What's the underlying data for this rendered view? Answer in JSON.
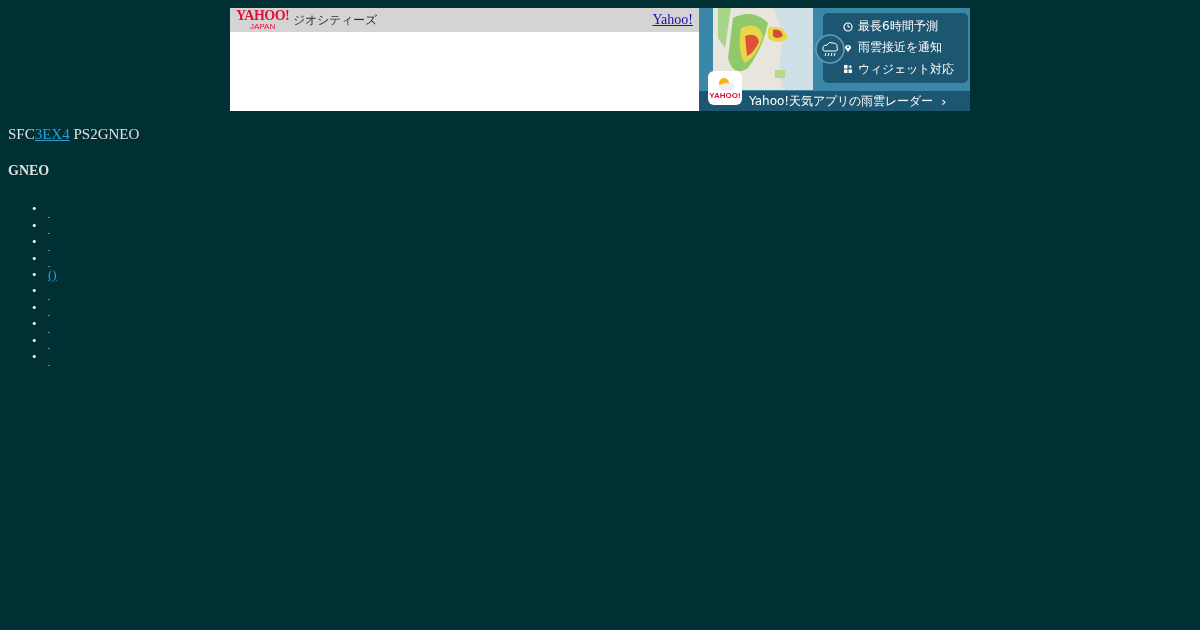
{
  "ad": {
    "logo": {
      "brand": "YAHOO!",
      "sub": "JAPAN",
      "service": "ジオシティーズ"
    },
    "link": "Yahoo!",
    "banner": {
      "features": [
        {
          "kind": "clock",
          "text": "最長6時間予測"
        },
        {
          "kind": "pin",
          "text": "雨雲接近を通知"
        },
        {
          "kind": "widget",
          "text": "ウィジェット対応"
        }
      ],
      "app_icon_text": "YAHOO!",
      "cta": "Yahoo!天気アプリの雨雲レーダー",
      "cta_arrow": "›"
    }
  },
  "intro": {
    "before": "SFC",
    "link": "3EX4",
    "after": " PS2GNEO"
  },
  "heading": "GNEO",
  "links": [
    {
      "marker": "•",
      "kind": "blank"
    },
    {
      "marker": "•",
      "kind": "blank"
    },
    {
      "marker": "•",
      "kind": "blank"
    },
    {
      "marker": "•",
      "kind": "blank"
    },
    {
      "marker": "•",
      "kind": "text",
      "text": "()"
    },
    {
      "marker": "•",
      "kind": "blank"
    },
    {
      "marker": "•",
      "kind": "blank"
    },
    {
      "marker": "•",
      "kind": "blank"
    },
    {
      "marker": "•",
      "kind": "blank"
    },
    {
      "marker": "•",
      "kind": "blank"
    }
  ]
}
